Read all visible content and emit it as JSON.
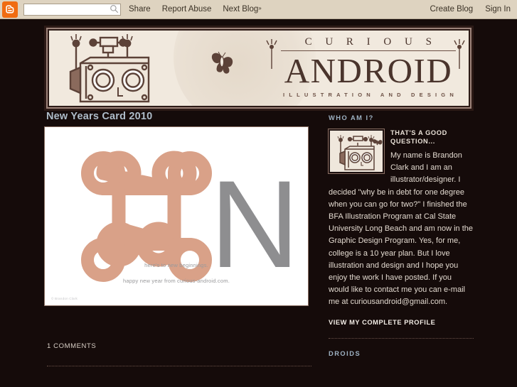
{
  "navbar": {
    "logo_icon": "blogger-b-icon",
    "search_placeholder": "",
    "search_value": "",
    "search_icon": "search-icon",
    "links": [
      {
        "label": "Share"
      },
      {
        "label": "Report Abuse"
      },
      {
        "label": "Next Blog",
        "suffix": "»"
      }
    ],
    "right_links": [
      {
        "label": "Create Blog"
      },
      {
        "label": "Sign In"
      }
    ],
    "bg_color": "#ded3c0"
  },
  "banner": {
    "title_top": "C U R I O U S",
    "title_main": "ANDROID",
    "subtitle": "ILLUSTRATION AND DESIGN",
    "art_icon": "robot-head-illustration",
    "butterfly_icon": "butterfly-icon",
    "moon_icon": "moon-icon",
    "ink_color": "#4a342c",
    "paper_color": "#f1e9de"
  },
  "post": {
    "title": "New Years Card 2010",
    "title_color": "#aebcc9",
    "card": {
      "symbol_icon": "command-key-icon",
      "symbol_color": "#d9a188",
      "letter": "N",
      "letter_color": "#8e8e90",
      "caption_1": "here's to new beginnings.",
      "caption_2": "happy new year from curious-android.com.",
      "credit": "© Brandon Clark"
    },
    "comments_label": "1 COMMENTS"
  },
  "sidebar": {
    "who_heading": "WHO AM I?",
    "profile": {
      "avatar_icon": "robot-avatar-thumbnail",
      "subheading": "THAT'S A GOOD QUESTION...",
      "bio": "My name is Brandon Clark and I am an illustrator/designer. I decided \"why be in debt for one degree when you can go for two?\" I finished the BFA Illustration Program at Cal State University Long Beach and am now in the Graphic Design Program. Yes, for me, college is a 10 year plan. But I love illustration and design and I hope you enjoy the work I have posted. If you would like to contact me you can e-mail me at curiousandroid@gmail.com.",
      "profile_link": "VIEW MY COMPLETE PROFILE"
    },
    "droids_heading": "DROIDS",
    "heading_color": "#9fb3c4"
  },
  "page": {
    "background_color": "#150b0a"
  }
}
